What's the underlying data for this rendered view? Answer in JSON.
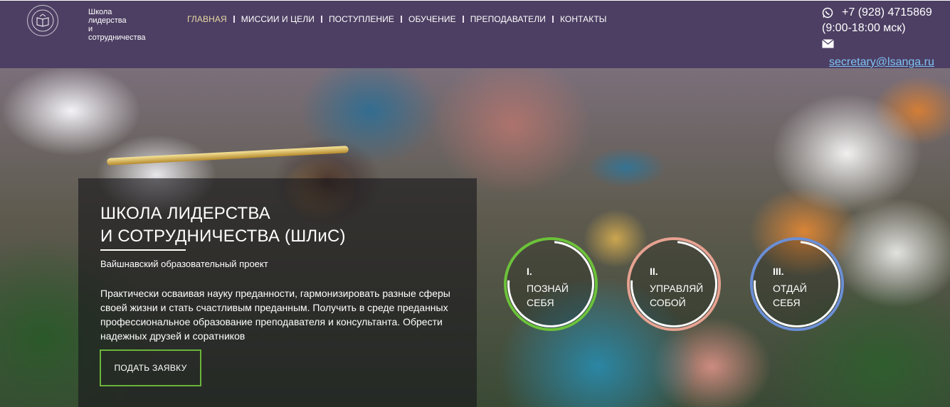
{
  "logo": {
    "lines": [
      "Школа",
      "лидерства",
      "и",
      "сотрудничества"
    ]
  },
  "nav": {
    "items": [
      {
        "label": "ГЛАВНАЯ",
        "active": true
      },
      {
        "label": "МИССИИ И ЦЕЛИ",
        "active": false
      },
      {
        "label": "ПОСТУПЛЕНИЕ",
        "active": false
      },
      {
        "label": "ОБУЧЕНИЕ",
        "active": false
      },
      {
        "label": "ПРЕПОДАВАТЕЛИ",
        "active": false
      },
      {
        "label": "КОНТАКТЫ",
        "active": false
      }
    ]
  },
  "contacts": {
    "phone": "+7 (928) 4715869",
    "hours": "(9:00-18:00 мск)",
    "email": "secretary@lsanga.ru"
  },
  "hero": {
    "title_line1": "ШКОЛА ЛИДЕРСТВА",
    "title_line2": "И СОТРУДНИЧЕСТВА (ШЛиС)",
    "subtitle": "Вайшнавский образовательный проект",
    "description": "Практически осваивая науку преданности, гармонизировать разные сферы своей жизни и стать счастливым преданным. Получить в среде преданных профессиональное образование преподавателя и консультанта. Обрести надежных друзей и соратников",
    "cta_label": "ПОДАТЬ ЗАЯВКУ"
  },
  "steps": [
    {
      "num": "I.",
      "line1": "ПОЗНАЙ",
      "line2": "СЕБЯ",
      "color": "#6cc23a"
    },
    {
      "num": "II.",
      "line1": "УПРАВЛЯЙ",
      "line2": "СОБОЙ",
      "color": "#e7a291"
    },
    {
      "num": "III.",
      "line1": "ОТДАЙ",
      "line2": "СЕБЯ",
      "color": "#6b8fd6"
    }
  ],
  "colors": {
    "header_bg": "#4d3f63",
    "nav_active": "#e8d9a5",
    "email_link": "#7ec3f5",
    "cta_border": "#6ab43a"
  }
}
